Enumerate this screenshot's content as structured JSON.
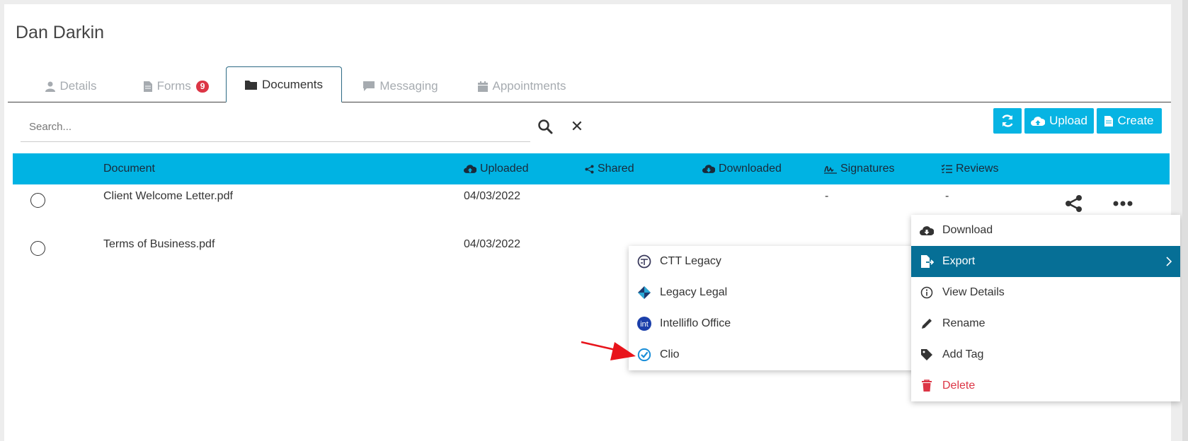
{
  "page_title": "Dan Darkin",
  "tabs": [
    {
      "label": "Details",
      "icon": "user-icon"
    },
    {
      "label": "Forms",
      "icon": "file-icon",
      "badge": "9"
    },
    {
      "label": "Documents",
      "icon": "folder-icon",
      "active": true
    },
    {
      "label": "Messaging",
      "icon": "chat-icon"
    },
    {
      "label": "Appointments",
      "icon": "calendar-icon"
    }
  ],
  "search": {
    "placeholder": "Search...",
    "value": ""
  },
  "toolbar": {
    "refresh_icon": "refresh-icon",
    "upload_label": "Upload",
    "create_label": "Create"
  },
  "table": {
    "columns": {
      "document": "Document",
      "uploaded": "Uploaded",
      "shared": "Shared",
      "downloaded": "Downloaded",
      "signatures": "Signatures",
      "reviews": "Reviews"
    },
    "rows": [
      {
        "name": "Client Welcome Letter.pdf",
        "uploaded": "04/03/2022",
        "signatures": "-",
        "reviews": "-"
      },
      {
        "name": "Terms of Business.pdf",
        "uploaded": "04/03/2022",
        "signatures": "",
        "reviews": ""
      }
    ]
  },
  "context_menu": {
    "items": [
      "Download",
      "Export",
      "View Details",
      "Rename",
      "Add Tag",
      "Delete"
    ]
  },
  "export_submenu": {
    "items": [
      "CTT Legacy",
      "Legacy Legal",
      "Intelliflo Office",
      "Clio"
    ]
  },
  "colors": {
    "primary": "#07b4e3",
    "header": "#00b3e3",
    "active_menu": "#066f96",
    "danger": "#dc3545",
    "annotation_arrow": "#e8141b"
  }
}
